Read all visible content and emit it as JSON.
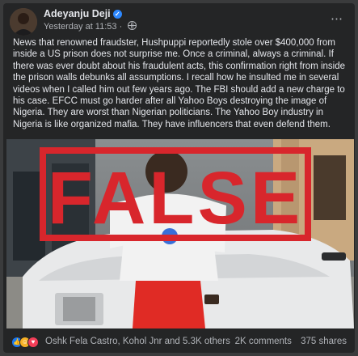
{
  "post": {
    "author": "Adeyanju Deji",
    "timestamp": "Yesterday at 11:53",
    "separator": "·",
    "more_icon": "⋯",
    "body": "News that renowned fraudster, Hushpuppi reportedly stole over $400,000 from inside a US prison does not surprise me. Once a criminal, always a criminal. If there was ever doubt about his fraudulent acts, this confirmation right from inside the prison walls debunks all assumptions. I recall how he insulted me in several videos when I called him out few years ago. The FBI should add a new charge to his case. EFCC must go harder after all Yahoo Boys destroying the image of Nigeria. They are worst than Nigerian politicians. The Yahoo Boy industry in Nigeria is like organized mafia. They have influencers that even defend them."
  },
  "image": {
    "stamp_text": "FALSE",
    "stamp_color": "#d8262c"
  },
  "footer": {
    "reactors": "Oshk Fela Castro, Kohol Jnr and 5.3K others",
    "comments": "2K comments",
    "shares": "375 shares"
  },
  "colors": {
    "card_bg": "#242526",
    "page_bg": "#3a3b3c",
    "text_primary": "#e4e6eb",
    "text_secondary": "#b0b3b8",
    "verified_blue": "#2d88ff"
  }
}
